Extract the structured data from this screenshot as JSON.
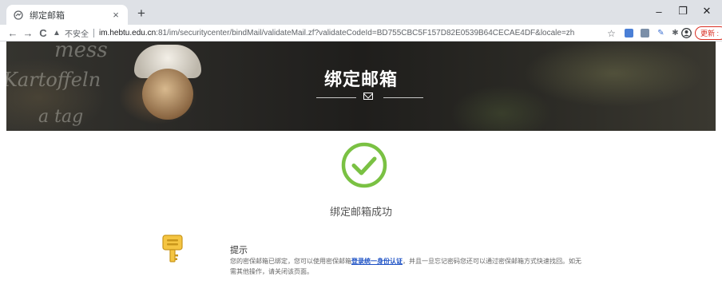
{
  "browser": {
    "tab_title": "绑定邮箱",
    "tab_close": "×",
    "new_tab": "+",
    "window_controls": {
      "minimize": "–",
      "restore": "❐",
      "close": "✕"
    },
    "nav": {
      "back": "←",
      "forward": "→",
      "reload": "C"
    },
    "security_label": "不安全",
    "url_host": "im.hebtu.edu.cn",
    "url_path": ":81/im/securitycenter/bindMail/validateMail.zf?validateCodeId=BD755CBC5F157D82E0539B64CECAE4DF&locale=zh",
    "update_button": "更新 :",
    "icons": [
      "star-icon",
      "extension-icon-blue",
      "extension-icon-grey",
      "pen-icon",
      "puzzle-icon",
      "profile-icon"
    ]
  },
  "banner": {
    "title": "绑定邮箱",
    "chalk_text": [
      "mess",
      "Kartoffeln",
      "a tag"
    ]
  },
  "main": {
    "success_text": "绑定邮箱成功",
    "accent_color": "#7ac143",
    "tip": {
      "title": "提示",
      "text_before": "您的密保邮箱已绑定，您可以使用密保邮箱",
      "link_text": "登录统一身份认证",
      "text_after": "，并且一旦忘记密码您还可以通过密保邮箱方式快速找回。如无需其他操作，请关闭该页面。"
    }
  }
}
